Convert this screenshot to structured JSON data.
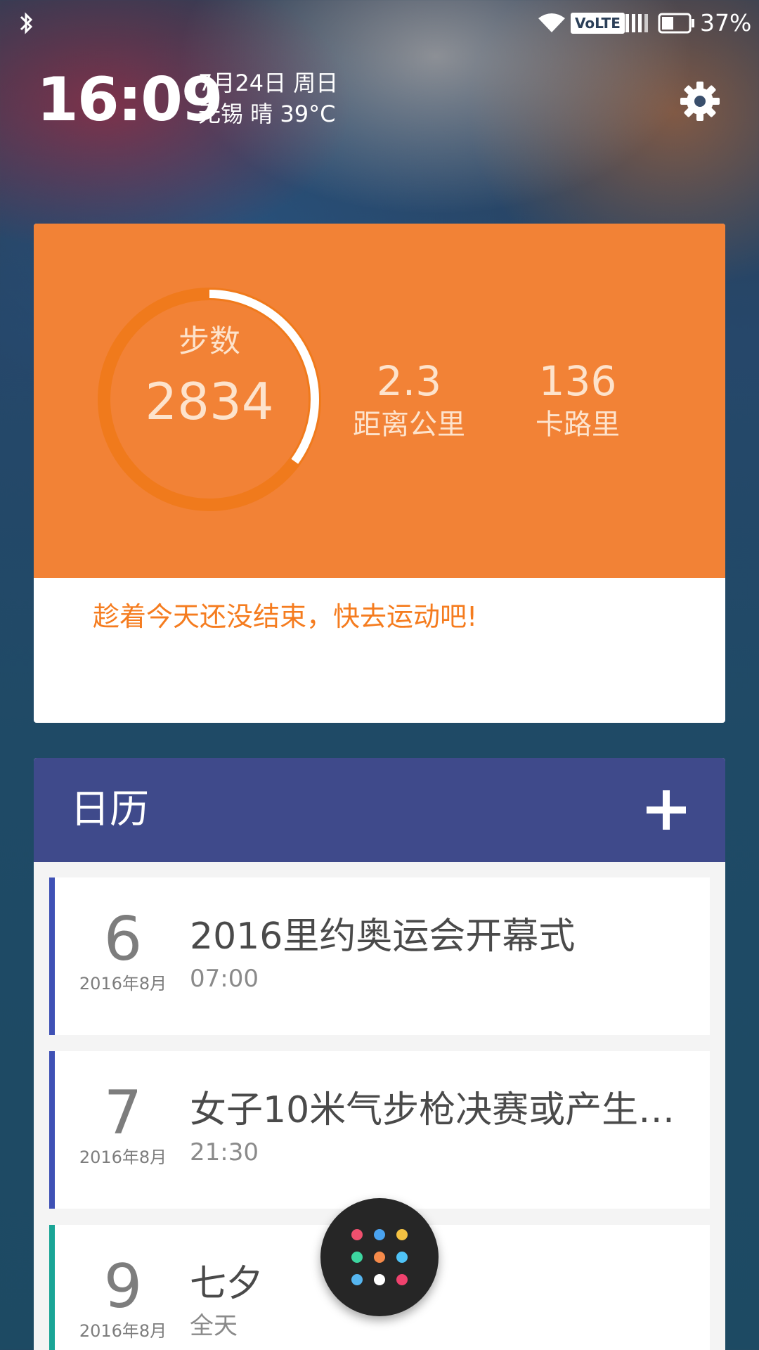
{
  "status_bar": {
    "battery_percent": "37%",
    "network_badge": "VoLTE",
    "icons": [
      "bluetooth-icon",
      "wifi-icon",
      "signal-icon",
      "battery-icon"
    ]
  },
  "header": {
    "time": "16:09",
    "date": "7月24日 周日",
    "weather": "无锡 晴 39°C",
    "settings_icon": "gear-icon"
  },
  "steps_card": {
    "steps_label": "步数",
    "steps_value": "2834",
    "ring_progress": 0.35,
    "distance_value": "2.3",
    "distance_label": "距离公里",
    "calories_value": "136",
    "calories_label": "卡路里",
    "message": "趁着今天还没结束，快去运动吧!",
    "colors": {
      "card": "#f28236",
      "ring_track": "#f07a1c",
      "ring_fill": "#ffffff",
      "message": "#f57c1f"
    }
  },
  "calendar": {
    "title": "日历",
    "add_icon": "plus-icon",
    "header_color": "#3f4a8b",
    "events": [
      {
        "day": "6",
        "month": "2016年8月",
        "title": "2016里约奥运会开幕式",
        "time": "07:00",
        "color": "#3f51b5"
      },
      {
        "day": "7",
        "month": "2016年8月",
        "title": "女子10米气步枪决赛或产生…",
        "time": "21:30",
        "color": "#3f51b5"
      },
      {
        "day": "9",
        "month": "2016年8月",
        "title": "七夕",
        "time": "全天",
        "color": "#1aa596"
      }
    ]
  },
  "fab": {
    "icon": "app-drawer-icon",
    "dot_colors": [
      "#f0506e",
      "#4aa3f0",
      "#f5c242",
      "#3dd6a0",
      "#f58a4a",
      "#4fc3f7",
      "#56b6f0",
      "#ffffff",
      "#f0426e"
    ]
  }
}
